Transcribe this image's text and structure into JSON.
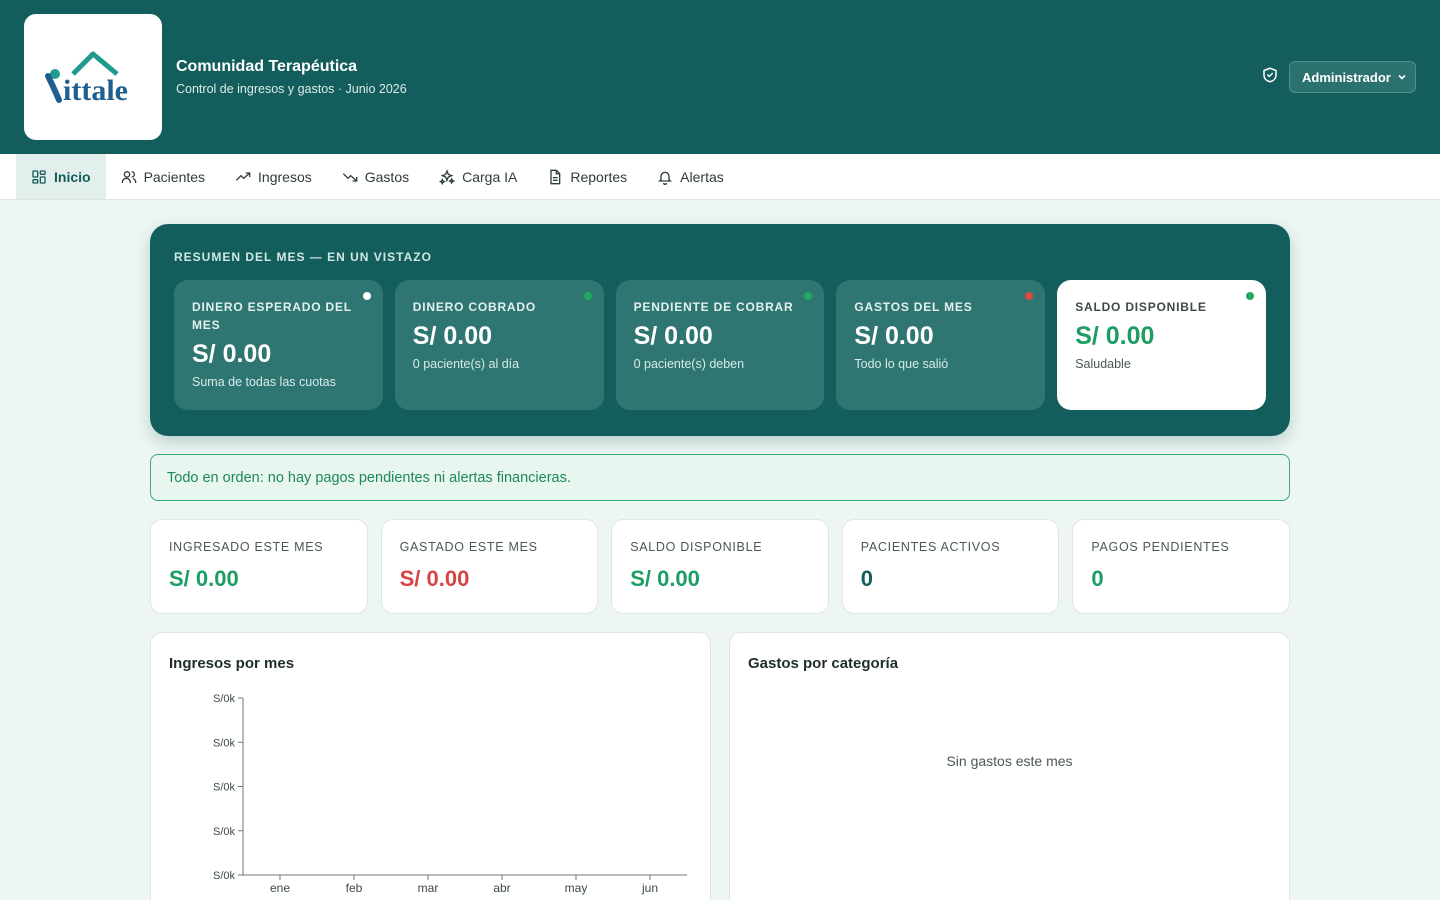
{
  "header": {
    "title": "Comunidad Terapéutica",
    "subtitle": "Control de ingresos y gastos · Junio 2026",
    "role": "Administrador",
    "logo_text": "ittale"
  },
  "nav": {
    "items": [
      {
        "label": "Inicio",
        "icon": "grid-icon"
      },
      {
        "label": "Pacientes",
        "icon": "users-icon"
      },
      {
        "label": "Ingresos",
        "icon": "trending-up-icon"
      },
      {
        "label": "Gastos",
        "icon": "trending-down-icon"
      },
      {
        "label": "Carga IA",
        "icon": "sparkles-icon"
      },
      {
        "label": "Reportes",
        "icon": "document-icon"
      },
      {
        "label": "Alertas",
        "icon": "bell-icon"
      }
    ]
  },
  "summary": {
    "heading": "RESUMEN DEL MES — EN UN VISTAZO",
    "cards": [
      {
        "label": "DINERO ESPERADO DEL MES",
        "value": "S/ 0.00",
        "sub": "Suma de todas las cuotas",
        "dot": "#ffffff"
      },
      {
        "label": "DINERO COBRADO",
        "value": "S/ 0.00",
        "sub": "0 paciente(s) al día",
        "dot": "#22a861"
      },
      {
        "label": "PENDIENTE DE COBRAR",
        "value": "S/ 0.00",
        "sub": "0 paciente(s) deben",
        "dot": "#22a861"
      },
      {
        "label": "GASTOS DEL MES",
        "value": "S/ 0.00",
        "sub": "Todo lo que salió",
        "dot": "#e04848"
      },
      {
        "label": "SALDO DISPONIBLE",
        "value": "S/ 0.00",
        "sub": "Saludable",
        "dot": "#22a861"
      }
    ]
  },
  "notice": "Todo en orden: no hay pagos pendientes ni alertas financieras.",
  "kpis": [
    {
      "label": "INGRESADO ESTE MES",
      "value": "S/ 0.00",
      "color": "#1e9d63"
    },
    {
      "label": "GASTADO ESTE MES",
      "value": "S/ 0.00",
      "color": "#d64545"
    },
    {
      "label": "SALDO DISPONIBLE",
      "value": "S/ 0.00",
      "color": "#1e9d63"
    },
    {
      "label": "PACIENTES ACTIVOS",
      "value": "0",
      "color": "#135e5c"
    },
    {
      "label": "PAGOS PENDIENTES",
      "value": "0",
      "color": "#1e9d63"
    }
  ],
  "panels": {
    "income_title": "Ingresos por mes",
    "expenses_title": "Gastos por categoría",
    "expenses_empty": "Sin gastos este mes"
  },
  "chart_data": {
    "type": "bar",
    "categories": [
      "ene",
      "feb",
      "mar",
      "abr",
      "may",
      "jun"
    ],
    "values": [
      0,
      0,
      0,
      0,
      0,
      0
    ],
    "y_tick_labels": [
      "S/0k",
      "S/0k",
      "S/0k",
      "S/0k",
      "S/0k"
    ],
    "title": "Ingresos por mes",
    "xlabel": "",
    "ylabel": "",
    "ylim": [
      0,
      0
    ],
    "grid": false
  }
}
